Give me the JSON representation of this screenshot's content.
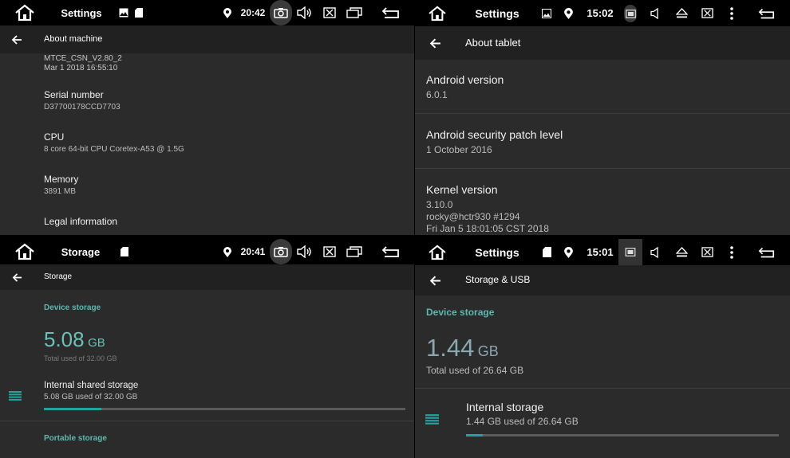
{
  "panels": {
    "tl": {
      "status": {
        "title": "Settings",
        "time": "20:42"
      },
      "appbar": {
        "title": "About machine"
      },
      "items": [
        {
          "line1": "MTCE_CSN_V2.80_2",
          "line2": "Mar  1 2018 16:55:10"
        },
        {
          "title": "Serial number",
          "summary": "D37700178CCD7703"
        },
        {
          "title": "CPU",
          "summary": "8 core 64-bit CPU Coretex-A53 @ 1.5G"
        },
        {
          "title": "Memory",
          "summary": "3891 MB"
        },
        {
          "title": "Legal information"
        }
      ]
    },
    "tr": {
      "status": {
        "title": "Settings",
        "time": "15:02"
      },
      "appbar": {
        "title": "About tablet"
      },
      "items": [
        {
          "title": "Android version",
          "summary": "6.0.1"
        },
        {
          "title": "Android security patch level",
          "summary": "1 October 2016"
        },
        {
          "title": "Kernel version",
          "summary1": "3.10.0",
          "summary2": "rocky@hctr930 #1294",
          "summary3": "Fri Jan 5 18:01:05 CST 2018"
        }
      ]
    },
    "bl": {
      "status": {
        "title": "Storage",
        "time": "20:41"
      },
      "appbar": {
        "title": "Storage"
      },
      "device_storage_header": "Device storage",
      "used_value": "5.08",
      "used_unit": "GB",
      "total_text": "Total used of 32.00 GB",
      "internal": {
        "title": "Internal shared storage",
        "summary": "5.08 GB used of 32.00 GB",
        "fraction": 0.159
      },
      "portable_header": "Portable storage"
    },
    "br": {
      "status": {
        "title": "Settings",
        "time": "15:01"
      },
      "appbar": {
        "title": "Storage & USB"
      },
      "device_storage_header": "Device storage",
      "used_value": "1.44",
      "used_unit": "GB",
      "total_text": "Total used of 26.64 GB",
      "internal": {
        "title": "Internal storage",
        "summary": "1.44 GB used of 26.64 GB",
        "fraction": 0.054
      }
    }
  },
  "colors": {
    "accent": "#5fb7b0",
    "progress": "#22a3a0",
    "background": "#2b2b2b",
    "appbar": "#212121",
    "statusbar": "#000000"
  },
  "icons": [
    "home-icon",
    "image-icon",
    "sd-card-icon",
    "location-icon",
    "camera-icon",
    "volume-icon",
    "close-box-icon",
    "window-icon",
    "back-icon",
    "eject-icon",
    "more-vert-icon",
    "arrow-back-icon",
    "storage-list-icon"
  ]
}
